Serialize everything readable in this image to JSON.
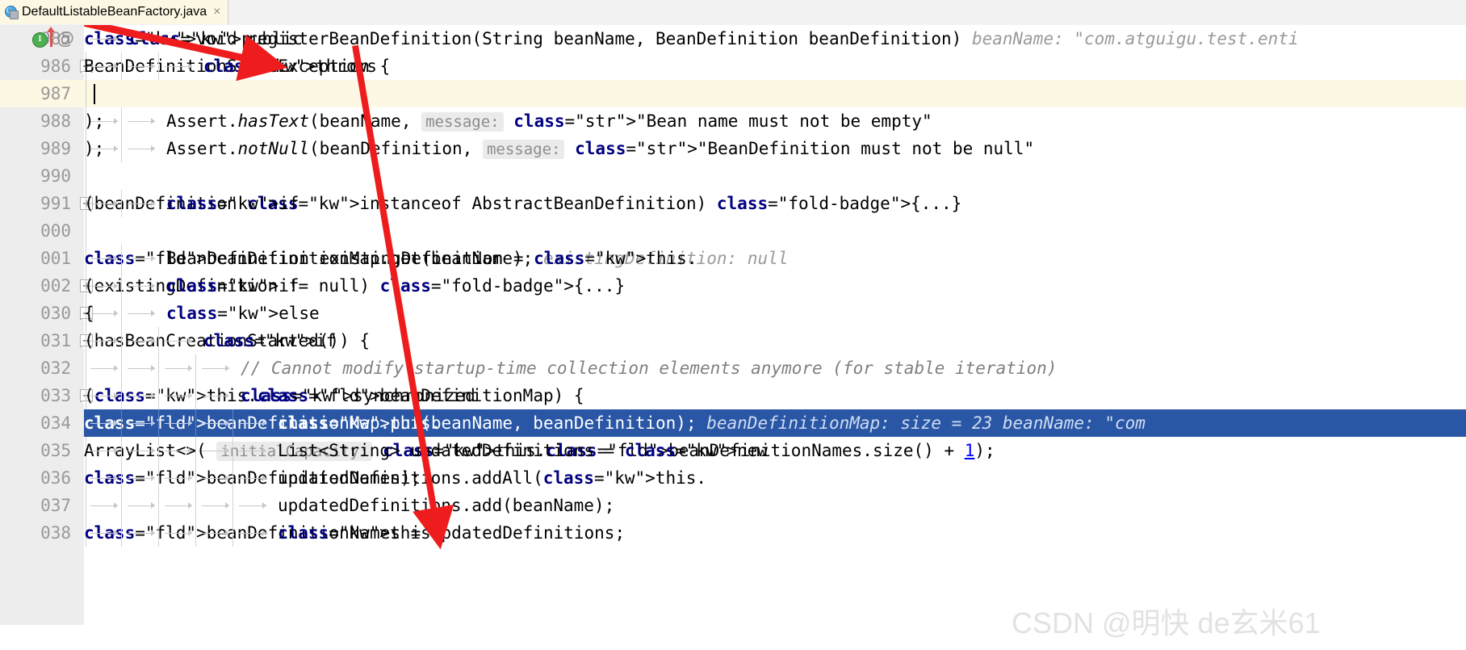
{
  "window": {
    "tab": {
      "label": "DefaultListableBeanFactory.java",
      "close": "×",
      "file_icon": "java-class-icon",
      "class_letter": "C"
    }
  },
  "editor": {
    "gutter_icons": {
      "implementing_method": "I",
      "override_arrow": "override-arrow-icon",
      "annotation": "@"
    },
    "lines": [
      {
        "num": "985",
        "indent": 1,
        "fold": "none",
        "current": false,
        "selected": false,
        "code": "public void registerBeanDefinition(String beanName, BeanDefinition beanDefinition)",
        "hint": "beanName: \"com.atguigu.test.enti"
      },
      {
        "num": "986",
        "indent": 3,
        "fold": "minus-tail",
        "current": false,
        "selected": false,
        "code": "throws BeanDefinitionStoreException {",
        "hint": ""
      },
      {
        "num": "987",
        "indent": 0,
        "fold": "none",
        "current": true,
        "selected": false,
        "code": "",
        "hint": ""
      },
      {
        "num": "988",
        "indent": 2,
        "fold": "none",
        "current": false,
        "selected": false,
        "code": "Assert.hasText(beanName,",
        "hint": "message:",
        "after": "\"Bean name must not be empty\");"
      },
      {
        "num": "989",
        "indent": 2,
        "fold": "none",
        "current": false,
        "selected": false,
        "code": "Assert.notNull(beanDefinition,",
        "hint": "message:",
        "after": "\"BeanDefinition must not be null\");"
      },
      {
        "num": "990",
        "indent": 0,
        "fold": "none",
        "current": false,
        "selected": false,
        "code": "",
        "hint": ""
      },
      {
        "num": "991",
        "indent": 2,
        "fold": "plus",
        "current": false,
        "selected": false,
        "code": "if (beanDefinition instanceof AbstractBeanDefinition) {...}",
        "hint": ""
      },
      {
        "num": "000",
        "indent": 0,
        "fold": "none",
        "current": false,
        "selected": false,
        "code": "",
        "hint": ""
      },
      {
        "num": "001",
        "indent": 2,
        "fold": "none",
        "current": false,
        "selected": false,
        "code": "BeanDefinition existingDefinition = this.beanDefinitionMap.get(beanName);",
        "hint": "existingDefinition: null"
      },
      {
        "num": "002",
        "indent": 2,
        "fold": "plus",
        "current": false,
        "selected": false,
        "code": "if (existingDefinition != null) {...}",
        "hint": ""
      },
      {
        "num": "030",
        "indent": 2,
        "fold": "minus-tail",
        "current": false,
        "selected": false,
        "code": "else {",
        "hint": ""
      },
      {
        "num": "031",
        "indent": 3,
        "fold": "minus-tail",
        "current": false,
        "selected": false,
        "code": "if (hasBeanCreationStarted()) {",
        "hint": ""
      },
      {
        "num": "032",
        "indent": 4,
        "fold": "none",
        "current": false,
        "selected": false,
        "code": "// Cannot modify startup-time collection elements anymore (for stable iteration)",
        "hint": ""
      },
      {
        "num": "033",
        "indent": 4,
        "fold": "minus-tail",
        "current": false,
        "selected": false,
        "code": "synchronized (this.beanDefinitionMap) {",
        "hint": ""
      },
      {
        "num": "034",
        "indent": 5,
        "fold": "none",
        "current": false,
        "selected": true,
        "code": "this.beanDefinitionMap.put(beanName, beanDefinition);",
        "hint": "beanDefinitionMap:  size = 23   beanName: \"com"
      },
      {
        "num": "035",
        "indent": 5,
        "fold": "none",
        "current": false,
        "selected": false,
        "code": "List<String> updatedDefinitions = new ArrayList<>(",
        "hint": "initialCapacity:",
        "after": "this.beanDefinitionNames.size() + 1);"
      },
      {
        "num": "036",
        "indent": 5,
        "fold": "none",
        "current": false,
        "selected": false,
        "code": "updatedDefinitions.addAll(this.beanDefinitionNames);",
        "hint": ""
      },
      {
        "num": "037",
        "indent": 5,
        "fold": "none",
        "current": false,
        "selected": false,
        "code": "updatedDefinitions.add(beanName);",
        "hint": ""
      },
      {
        "num": "038",
        "indent": 5,
        "fold": "none",
        "current": false,
        "selected": false,
        "code": "this.beanDefinitionNames = updatedDefinitions;",
        "hint": ""
      }
    ]
  },
  "annotations": {
    "arrow_1": "red-arrow-icon",
    "arrow_2": "red-arrow-icon"
  },
  "watermark": {
    "text": "CSDN @明快 de玄米61"
  },
  "colors": {
    "selection": "#2a57a5",
    "current_line": "#fdf8e3",
    "gutter": "#ededed",
    "keyword": "#000080",
    "field": "#660e7a",
    "string": "#008000",
    "comment": "#808080",
    "annotation_arrow": "#ee1c1c"
  }
}
